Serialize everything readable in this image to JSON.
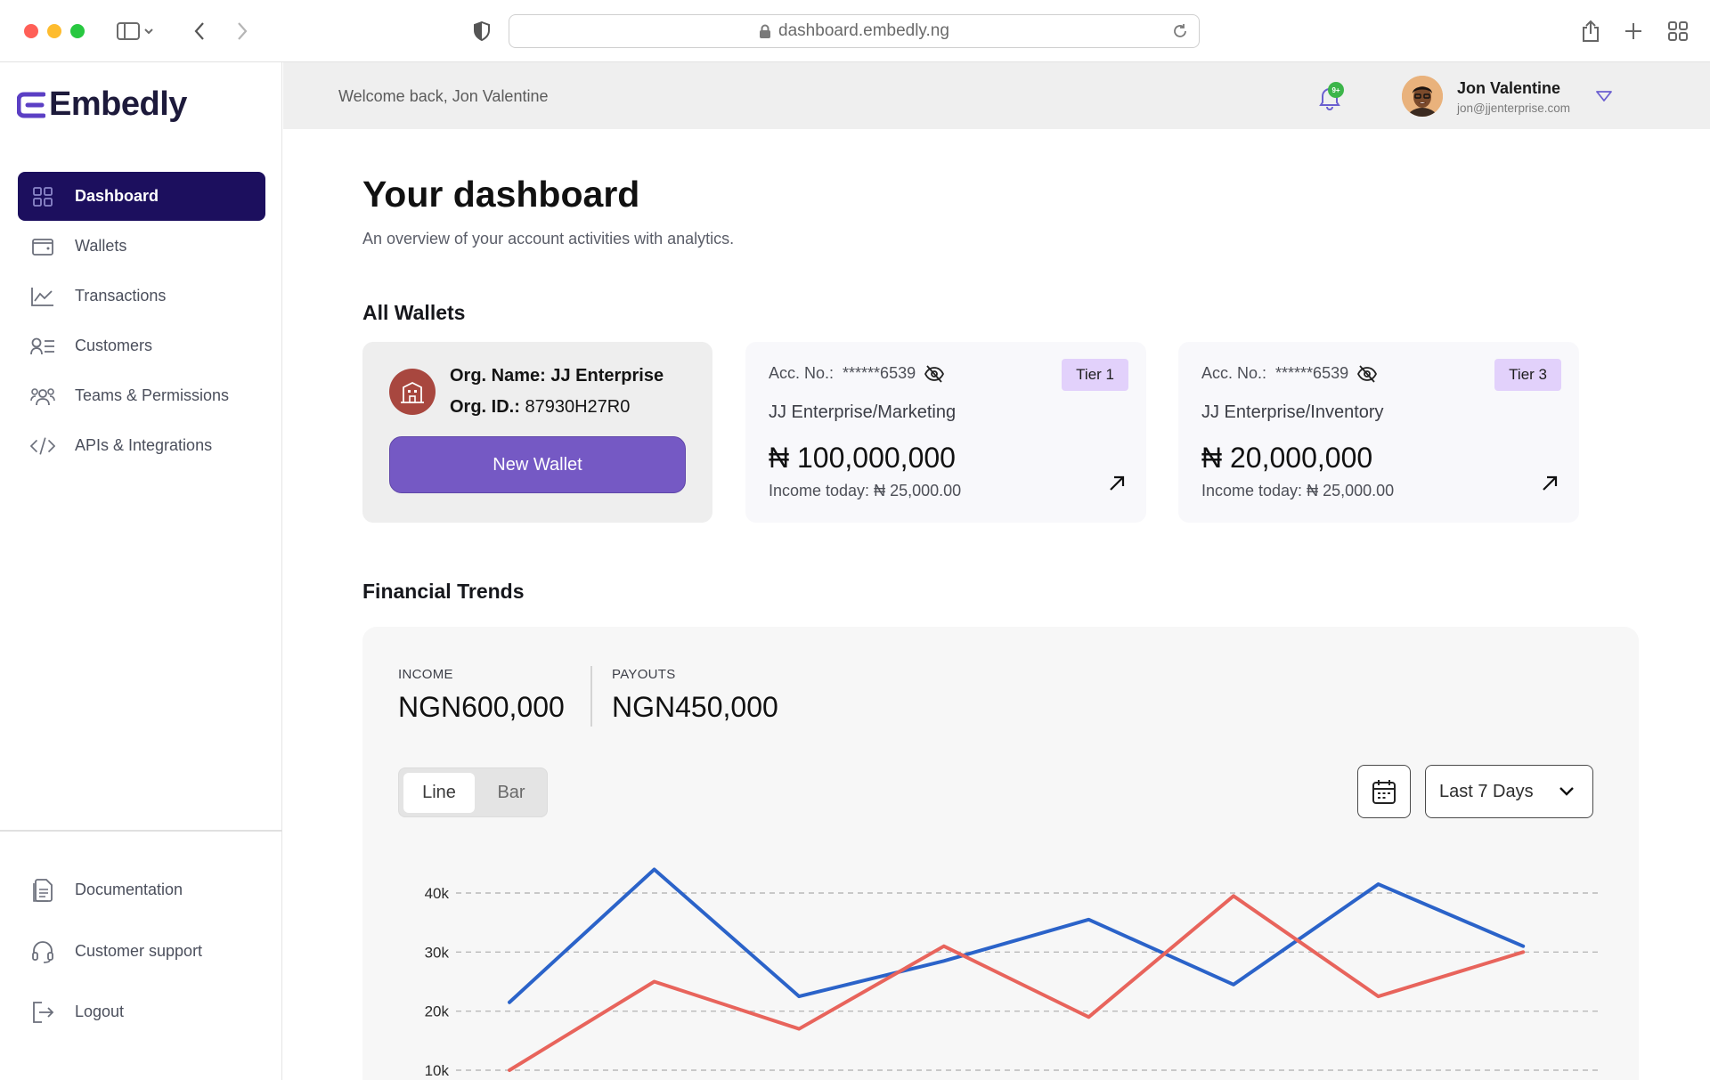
{
  "browser": {
    "url": "dashboard.embedly.ng"
  },
  "sidebar": {
    "logo": "Embedly",
    "nav": [
      {
        "label": "Dashboard",
        "icon": "grid-icon",
        "active": true
      },
      {
        "label": "Wallets",
        "icon": "wallet-icon"
      },
      {
        "label": "Transactions",
        "icon": "chart-icon"
      },
      {
        "label": "Customers",
        "icon": "user-list-icon"
      },
      {
        "label": "Teams & Permissions",
        "icon": "users-icon"
      },
      {
        "label": "APIs & Integrations",
        "icon": "code-icon"
      }
    ],
    "footer": [
      {
        "label": "Documentation",
        "icon": "document-icon"
      },
      {
        "label": "Customer support",
        "icon": "headset-icon"
      },
      {
        "label": "Logout",
        "icon": "logout-icon"
      }
    ]
  },
  "header": {
    "welcome_prefix": "Welcome back,",
    "welcome_name": "Jon Valentine",
    "notification_badge": "9+",
    "user_name": "Jon Valentine",
    "user_email": "jon@jjenterprise.com"
  },
  "main": {
    "title": "Your dashboard",
    "subtitle": "An overview of your account activities with analytics.",
    "wallets_title": "All Wallets",
    "org": {
      "name_label": "Org. Name:",
      "name": "JJ Enterprise",
      "id_label": "Org. ID.:",
      "id": "87930H27R0",
      "new_wallet_label": "New Wallet"
    },
    "wallets": [
      {
        "acc_label": "Acc. No.:",
        "acc_no": "******6539",
        "tier": "Tier 1",
        "name": "JJ Enterprise/Marketing",
        "balance": "₦ 100,000,000",
        "income_label": "Income today:",
        "income": "₦ 25,000.00"
      },
      {
        "acc_label": "Acc. No.:",
        "acc_no": "******6539",
        "tier": "Tier 3",
        "name": "JJ Enterprise/Inventory",
        "balance": "₦ 20,000,000",
        "income_label": "Income today:",
        "income": "₦ 25,000.00"
      }
    ],
    "trends_title": "Financial Trends",
    "income_label": "INCOME",
    "income_value": "NGN600,000",
    "payouts_label": "PAYOUTS",
    "payouts_value": "NGN450,000",
    "chart_types": [
      "Line",
      "Bar"
    ],
    "active_chart_type": "Line",
    "range": "Last 7 Days"
  },
  "colors": {
    "primary": "#1c0f5e",
    "button": "#7559c4",
    "tier": "#e2d1fb",
    "income_line": "#2b63c9",
    "payout_line": "#e8645c"
  },
  "chart_data": {
    "type": "line",
    "title": "",
    "xlabel": "",
    "ylabel": "",
    "ylim": [
      10000,
      45000
    ],
    "y_ticks": [
      "10k",
      "20k",
      "30k",
      "40k"
    ],
    "grid": "dashed horizontal",
    "series": [
      {
        "color": "#2b63c9",
        "values": [
          [
            0,
            21500
          ],
          [
            1,
            44000
          ],
          [
            2,
            22500
          ],
          [
            3,
            28500
          ],
          [
            4,
            35500
          ],
          [
            5,
            24500
          ],
          [
            6,
            41500
          ],
          [
            7,
            31000
          ]
        ]
      },
      {
        "color": "#e8645c",
        "values": [
          [
            0,
            10000
          ],
          [
            1,
            25000
          ],
          [
            2,
            17000
          ],
          [
            3,
            31000
          ],
          [
            4,
            19000
          ],
          [
            5,
            39500
          ],
          [
            6,
            22500
          ],
          [
            7,
            30000
          ]
        ]
      }
    ]
  }
}
